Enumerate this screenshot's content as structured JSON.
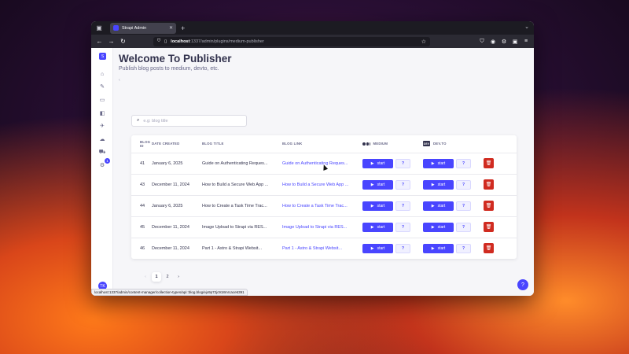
{
  "browser": {
    "tab_title": "Strapi Admin",
    "url_host": "localhost",
    "url_path": ":1337/admin/plugins/medium-publisher",
    "status_url": "localhost:1337/admin/content-manager/collection-types/api::blog.blog/ejx9p72jc918mrcace6391"
  },
  "sidebar": {
    "logo": "S",
    "badge": "1",
    "avatar": "TK"
  },
  "page": {
    "title": "Welcome To Publisher",
    "subtitle": "Publish blog posts to medium, devto, etc.",
    "back": "‹"
  },
  "search": {
    "placeholder": "e.g: blog title"
  },
  "table": {
    "headers": {
      "id": "BLOG ID",
      "date": "DATE CREATED",
      "title": "BLOG TITLE",
      "link": "BLOG LINK",
      "medium": "MEDIUM",
      "devto": "DEV.TO"
    },
    "devto_logo": "DEV",
    "start_label": "start",
    "help_label": "?",
    "rows": [
      {
        "id": "41",
        "date": "January 6, 2025",
        "title": "Guide on Authenticating Reques...",
        "link": "Guide on Authenticating Reques..."
      },
      {
        "id": "43",
        "date": "December 11, 2024",
        "title": "How to Build a Secure Web App ...",
        "link": "How to Build a Secure Web App ..."
      },
      {
        "id": "44",
        "date": "January 6, 2025",
        "title": "How to Create a Task Time Trac...",
        "link": "How to Create a Task Time Trac..."
      },
      {
        "id": "45",
        "date": "December 11, 2024",
        "title": "Image Upload to Strapi via RES...",
        "link": "Image Upload to Strapi via RES..."
      },
      {
        "id": "46",
        "date": "December 11, 2024",
        "title": "Part 1 - Astro & Strapi Websit...",
        "link": "Part 1 - Astro & Strapi Websit..."
      }
    ]
  },
  "pagination": {
    "prev": "‹",
    "pages": [
      "1",
      "2"
    ],
    "next": "›"
  },
  "colors": {
    "primary": "#4945ff",
    "danger": "#d02b20",
    "text": "#32324d"
  }
}
